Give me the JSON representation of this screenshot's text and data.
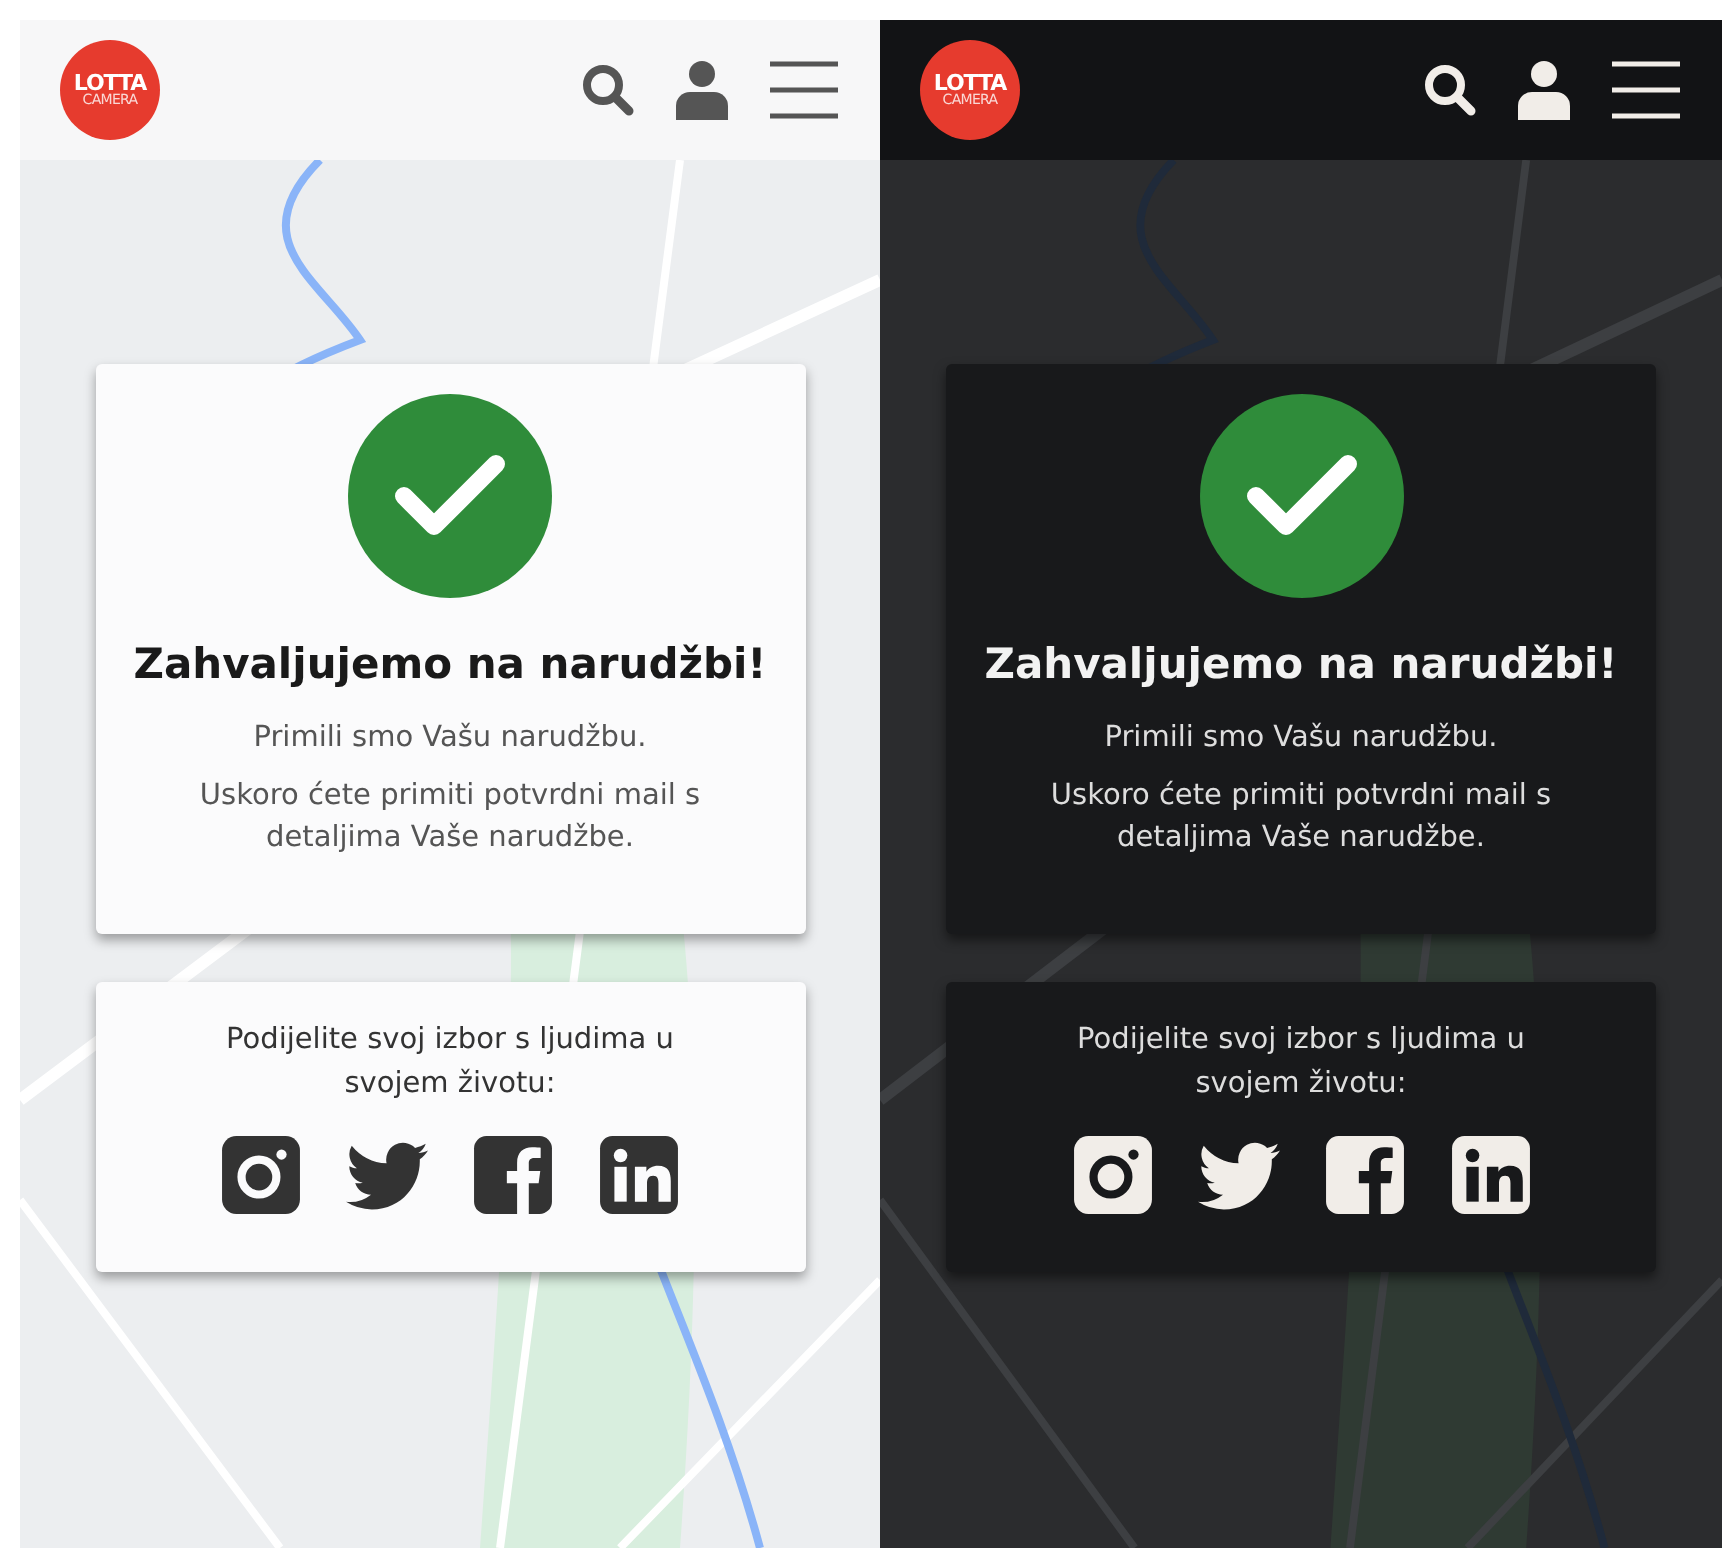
{
  "screens": [
    {
      "kind": "light",
      "logo": {
        "line_1": "LOTTA",
        "line_2": "CAMERA"
      },
      "title": "Zahvaljujemo na narudžbi!",
      "messages": [
        "Primili smo Vašu narudžbu.",
        "Uskoro ćete primiti potvrdni mail s detaljima Vaše narudžbe."
      ],
      "share_text": "Podijelite svoj izbor s ljudima u svojem životu:",
      "social": [
        {
          "kind": "instagram"
        },
        {
          "kind": "twitter"
        },
        {
          "kind": "facebook"
        },
        {
          "kind": "linkedin"
        }
      ]
    },
    {
      "kind": "dark",
      "logo": {
        "line_1": "LOTTA",
        "line_2": "CAMERA"
      },
      "title": "Zahvaljujemo na narudžbi!",
      "messages": [
        "Primili smo Vašu narudžbu.",
        "Uskoro ćete primiti potvrdni mail s detaljima Vaše narudžbe."
      ],
      "share_text": "Podijelite svoj izbor s ljudima u svojem životu:",
      "social": [
        {
          "kind": "instagram"
        },
        {
          "kind": "twitter"
        },
        {
          "kind": "facebook"
        },
        {
          "kind": "linkedin"
        }
      ]
    }
  ]
}
